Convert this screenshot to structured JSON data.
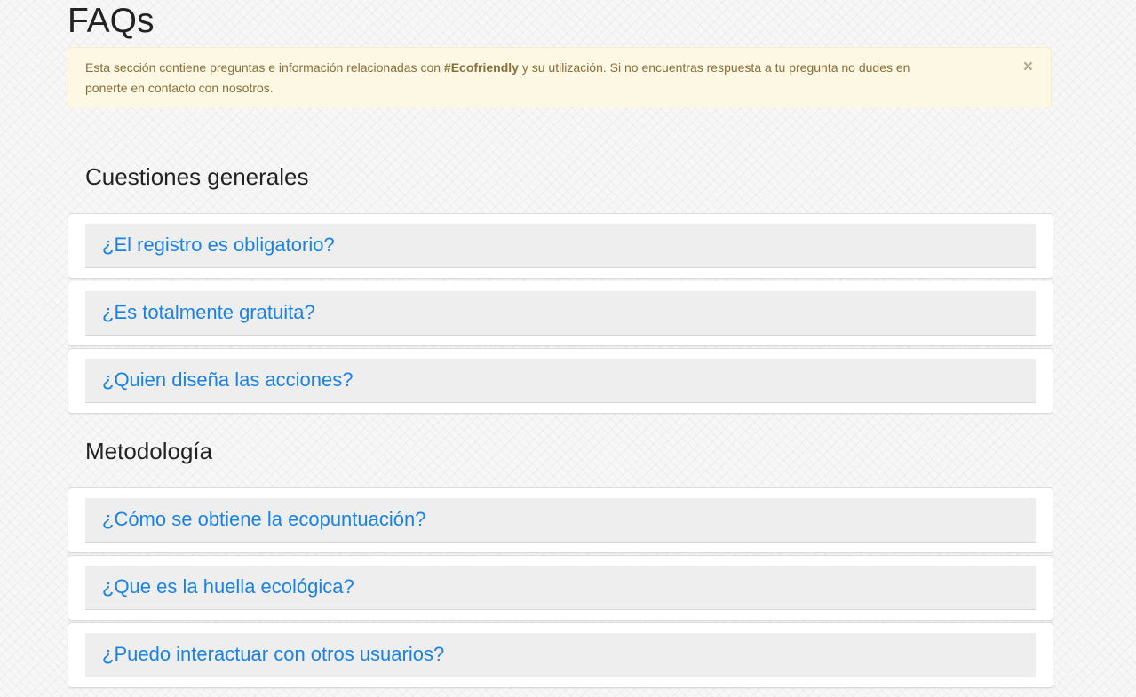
{
  "page": {
    "title": "FAQs"
  },
  "alert": {
    "text_before": "Esta sección contiene preguntas e información relacionadas con ",
    "highlight": "#Ecofriendly",
    "text_line1_after": " y su utilización. Si no encuentras respuesta a tu pregunta no dudes en",
    "text_line2": "ponerte en contacto con nosotros.",
    "close_label": "×"
  },
  "sections": [
    {
      "title": "Cuestiones generales",
      "questions": [
        {
          "label": "¿El registro es obligatorio?"
        },
        {
          "label": "¿Es totalmente gratuita?"
        },
        {
          "label": "¿Quien diseña las acciones?"
        }
      ]
    },
    {
      "title": "Metodología",
      "questions": [
        {
          "label": "¿Cómo se obtiene la ecopuntuación?"
        },
        {
          "label": "¿Que es la huella ecológica?"
        },
        {
          "label": "¿Puedo interactuar con otros usuarios?"
        }
      ]
    }
  ],
  "colors": {
    "link": "#1a82e2",
    "alert_bg": "#fcf8e3",
    "alert_text": "#8a6d3b"
  }
}
